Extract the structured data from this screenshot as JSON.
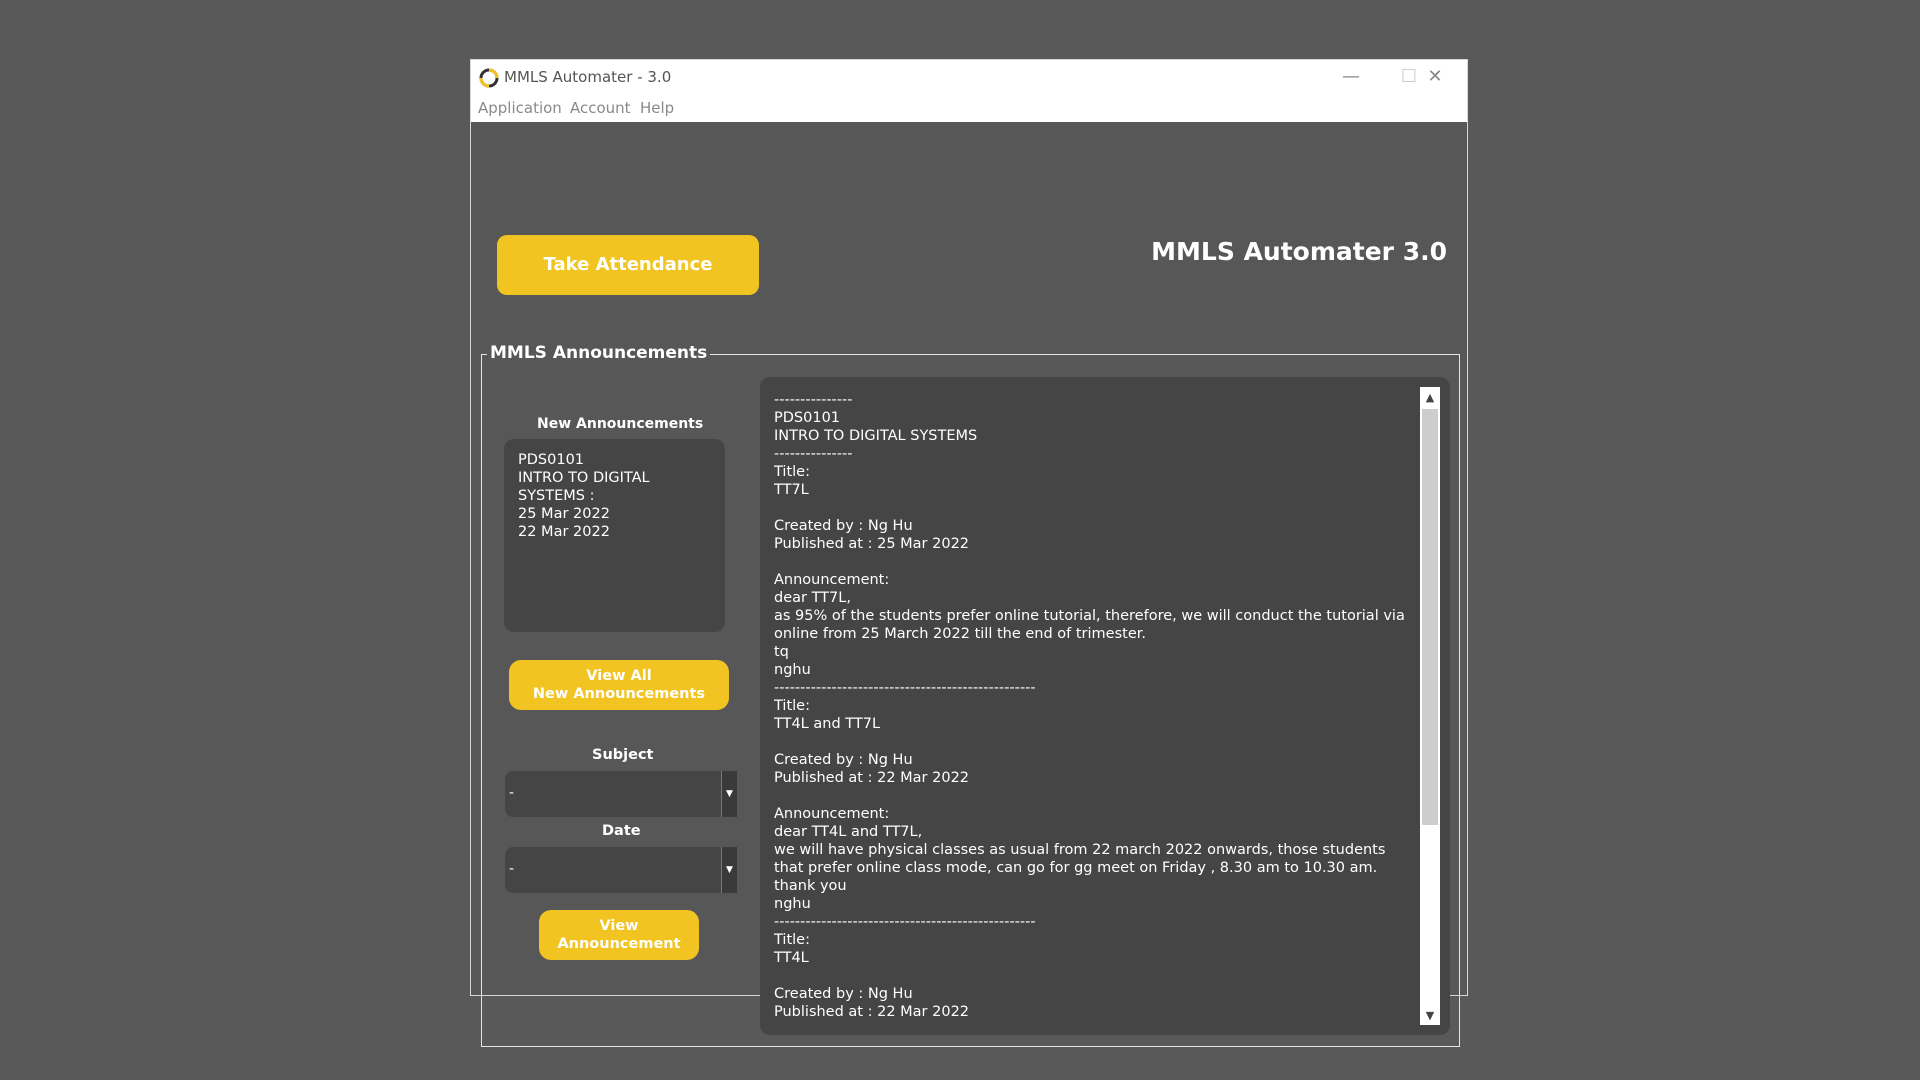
{
  "window": {
    "title": "MMLS Automater - 3.0",
    "icon": "mmls-logo-icon",
    "controls": {
      "minimize": "—",
      "maximize": "☐",
      "close": "✕"
    }
  },
  "menu": {
    "items": [
      {
        "label": "Application"
      },
      {
        "label": "Account"
      },
      {
        "label": "Help"
      }
    ]
  },
  "header": {
    "take_attendance_label": "Take Attendance",
    "app_heading": "MMLS Automater 3.0"
  },
  "announcements": {
    "group_title": "MMLS Announcements",
    "new_label": "New Announcements",
    "new_box_lines": "PDS0101\nINTRO TO DIGITAL\nSYSTEMS :\n25 Mar 2022\n22 Mar 2022",
    "view_all_label": "View All\nNew Announcements",
    "subject_label": "Subject",
    "subject_value": "-",
    "date_label": "Date",
    "date_value": "-",
    "view_announcement_label": "View\nAnnouncement",
    "detail_text": "---------------\nPDS0101\nINTRO TO DIGITAL SYSTEMS\n---------------\nTitle:\nTT7L\n\nCreated by : Ng Hu\nPublished at : 25 Mar 2022\n\nAnnouncement:\ndear TT7L,\nas 95% of the students prefer online tutorial, therefore, we will conduct the tutorial via online from 25 March 2022 till the end of trimester.\ntq\nnghu\n--------------------------------------------------\nTitle:\nTT4L and TT7L\n\nCreated by : Ng Hu\nPublished at : 22 Mar 2022\n\nAnnouncement:\ndear TT4L and TT7L,\nwe will have physical classes as usual from 22 march 2022 onwards, those students that prefer online class mode, can go for gg meet on Friday , 8.30 am to 10.30 am.\nthank you\nnghu\n--------------------------------------------------\nTitle:\nTT4L\n\nCreated by : Ng Hu\nPublished at : 22 Mar 2022"
  },
  "colors": {
    "accent": "#f2c422",
    "background": "#575757",
    "panel": "#454545"
  }
}
